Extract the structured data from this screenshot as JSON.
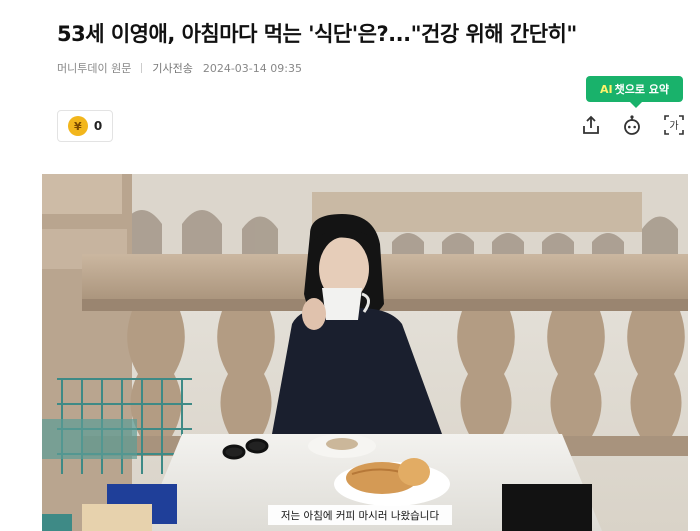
{
  "article": {
    "headline": "53세 이영애, 아침마다 먹는 '식단'은?...\"건강 위해 간단히\"",
    "source": "머니투데이 원문",
    "sent_label": "기사전송",
    "timestamp": "2024-03-14 09:35"
  },
  "ai_summary": {
    "ai": "AI",
    "label": "챗으로 요약"
  },
  "reactions": {
    "like_icon_glyph": "¥",
    "like_count": "0"
  },
  "toolbar": {
    "font_size_label": "가"
  },
  "photo": {
    "caption": "저는 아침에 커피 마시러 나왔습니다"
  },
  "colors": {
    "accent": "#19b26b",
    "like": "#f2b61c"
  },
  "icons": [
    "share-icon",
    "ai-bot-icon",
    "font-size-icon",
    "like-icon"
  ]
}
